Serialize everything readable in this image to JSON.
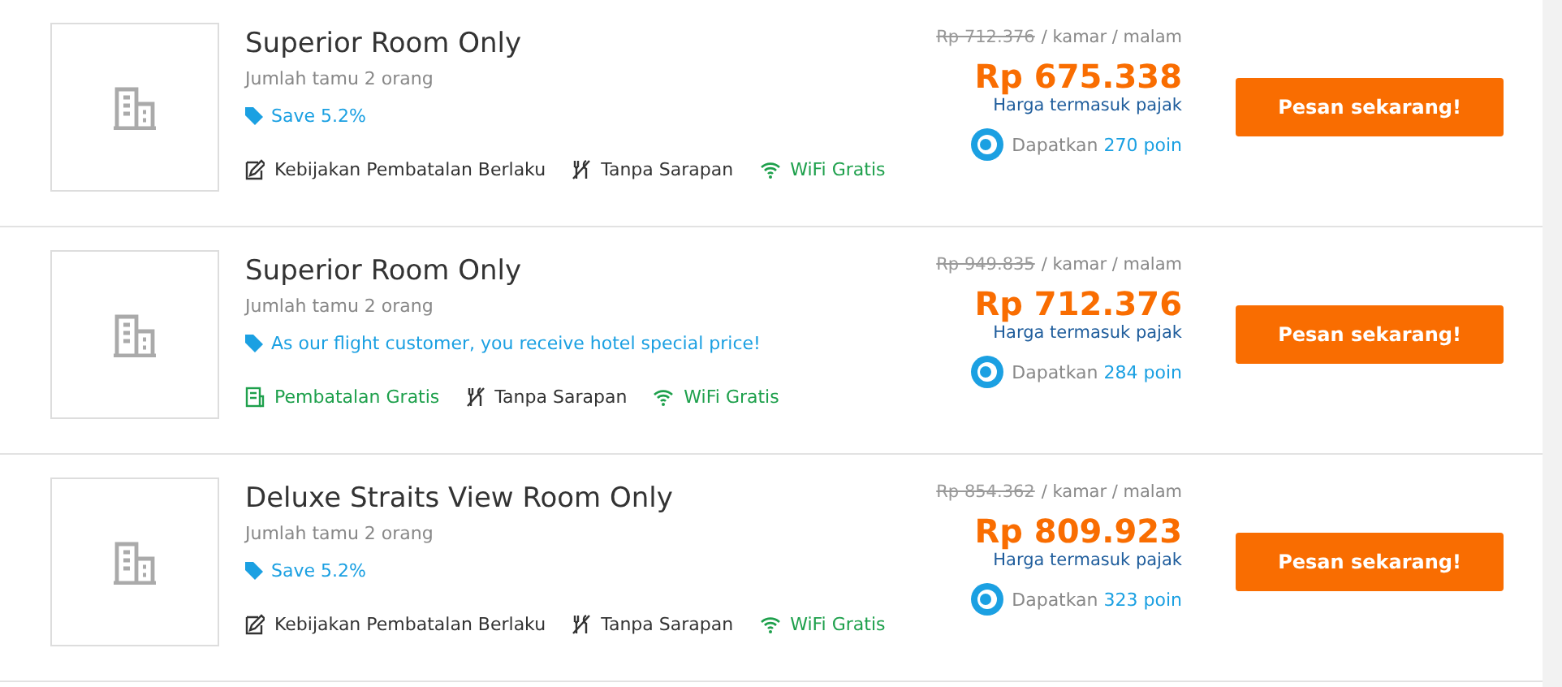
{
  "rooms": [
    {
      "name": "Superior Room Only",
      "guests": "Jumlah tamu 2 orang",
      "promo": "Save 5.2%",
      "features": [
        {
          "kind": "policy",
          "label": "Kebijakan Pembatalan Berlaku"
        },
        {
          "kind": "breakfast",
          "label": "Tanpa Sarapan"
        },
        {
          "kind": "wifi",
          "label": "WiFi Gratis"
        }
      ],
      "old_price": "Rp 712.376",
      "unit": "/ kamar / malam",
      "price": "Rp 675.338",
      "tax_note": "Harga termasuk pajak",
      "points_prefix": "Dapatkan",
      "points": "270 poin",
      "button": "Pesan sekarang!"
    },
    {
      "name": "Superior Room Only",
      "guests": "Jumlah tamu 2 orang",
      "promo": "As our flight customer, you receive hotel special price!",
      "features": [
        {
          "kind": "free-cancel",
          "label": "Pembatalan Gratis"
        },
        {
          "kind": "breakfast",
          "label": "Tanpa Sarapan"
        },
        {
          "kind": "wifi",
          "label": "WiFi Gratis"
        }
      ],
      "old_price": "Rp 949.835",
      "unit": "/ kamar / malam",
      "price": "Rp 712.376",
      "tax_note": "Harga termasuk pajak",
      "points_prefix": "Dapatkan",
      "points": "284 poin",
      "button": "Pesan sekarang!"
    },
    {
      "name": "Deluxe Straits View Room Only",
      "guests": "Jumlah tamu 2 orang",
      "promo": "Save 5.2%",
      "features": [
        {
          "kind": "policy",
          "label": "Kebijakan Pembatalan Berlaku"
        },
        {
          "kind": "breakfast",
          "label": "Tanpa Sarapan"
        },
        {
          "kind": "wifi",
          "label": "WiFi Gratis"
        }
      ],
      "old_price": "Rp 854.362",
      "unit": "/ kamar / malam",
      "price": "Rp 809.923",
      "tax_note": "Harga termasuk pajak",
      "points_prefix": "Dapatkan",
      "points": "323 poin",
      "button": "Pesan sekarang!"
    }
  ]
}
